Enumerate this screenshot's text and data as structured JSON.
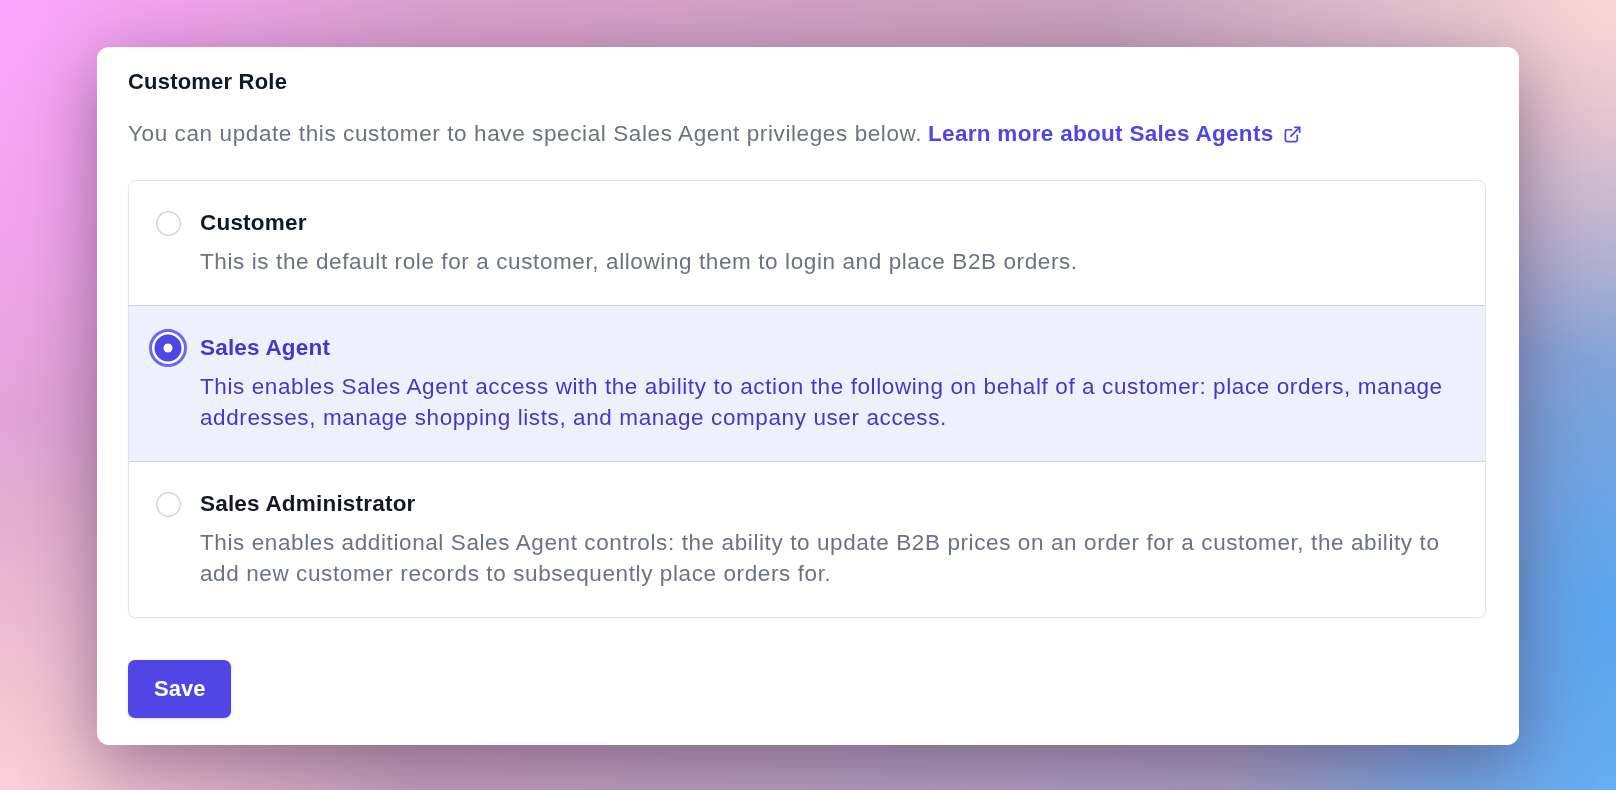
{
  "card": {
    "title": "Customer Role",
    "description": "You can update this customer to have special Sales Agent privileges below.",
    "link": {
      "label": "Learn more about Sales Agents"
    }
  },
  "roles": [
    {
      "name": "Customer",
      "description": "This is the default role for a customer, allowing them to login and place B2B orders.",
      "selected": false
    },
    {
      "name": "Sales Agent",
      "description": "This enables Sales Agent access with the ability to action the following on behalf of a customer: place orders, manage addresses, manage shopping lists, and manage company user access.",
      "selected": true
    },
    {
      "name": "Sales Administrator",
      "description": "This enables additional Sales Agent controls: the ability to update B2B prices on an order for a customer, the ability to add new customer records to subsequently place orders for.",
      "selected": false
    }
  ],
  "buttons": [
    {
      "label": "Save"
    }
  ]
}
